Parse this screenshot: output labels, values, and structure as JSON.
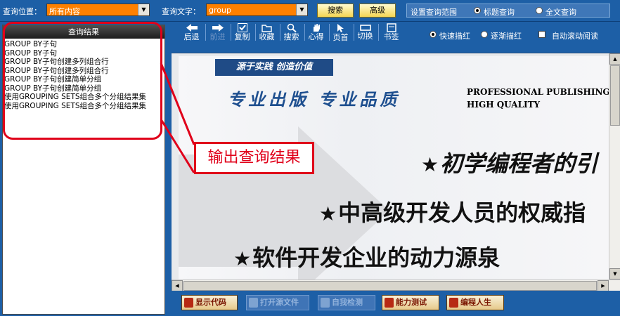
{
  "topbar": {
    "location_label": "查询位置：",
    "location_value": "所有内容",
    "text_label": "查询文字：",
    "text_value": "group",
    "search_button": "搜索",
    "advanced_button": "高级",
    "scope_label": "设置查询范围",
    "scope_options": [
      "标题查询",
      "全文查询"
    ],
    "scope_selected": "标题查询"
  },
  "results": {
    "header": "查询结果",
    "items": [
      "GROUP BY子句",
      "GROUP BY子句",
      "GROUP BY子句创建多列组合行",
      "GROUP BY子句创建多列组合行",
      "GROUP BY子句创建简单分组",
      "GROUP BY子句创建简单分组",
      "使用GROUPING SETS组合多个分组结果集",
      "使用GROUPING SETS组合多个分组结果集"
    ]
  },
  "toolbar": {
    "buttons": [
      {
        "label": "后退",
        "icon": "arrow-left-icon",
        "enabled": true
      },
      {
        "label": "前进",
        "icon": "arrow-right-icon",
        "enabled": false
      },
      {
        "label": "复制",
        "icon": "check-icon",
        "enabled": true
      },
      {
        "label": "收藏",
        "icon": "folder-icon",
        "enabled": true
      },
      {
        "label": "搜索",
        "icon": "search-icon",
        "enabled": true
      },
      {
        "label": "心得",
        "icon": "hand-icon",
        "enabled": true
      },
      {
        "label": "页首",
        "icon": "cursor-icon",
        "enabled": true
      },
      {
        "label": "切换",
        "icon": "window-icon",
        "enabled": true
      },
      {
        "label": "书签",
        "icon": "bookmark-icon",
        "enabled": true
      }
    ],
    "options": {
      "fast_highlight": "快速描红",
      "gradual_highlight": "逐渐描红",
      "auto_scroll": "自动滚动阅读",
      "selected": "快速描红",
      "auto_scroll_checked": false
    }
  },
  "document": {
    "slogan": "源于实践  创造价值",
    "motto": "专业出版 专业品质",
    "english_line1": "PROFESSIONAL PUBLISHING",
    "english_line2": "HIGH QUALITY",
    "features": [
      "初学编程者的引",
      "中高级开发人员的权威指",
      "软件开发企业的动力源泉"
    ]
  },
  "bottom_buttons": [
    {
      "label": "显示代码",
      "enabled": true
    },
    {
      "label": "打开源文件",
      "enabled": false
    },
    {
      "label": "自我检测",
      "enabled": false
    },
    {
      "label": "能力测试",
      "enabled": true
    },
    {
      "label": "编程人生",
      "enabled": true
    }
  ],
  "annotation": {
    "callout_text": "输出查询结果",
    "color": "#e0001a"
  },
  "colors": {
    "chrome_blue": "#1d5fa6",
    "combo_orange": "#ff8000",
    "motto_blue": "#1e4f8f"
  }
}
